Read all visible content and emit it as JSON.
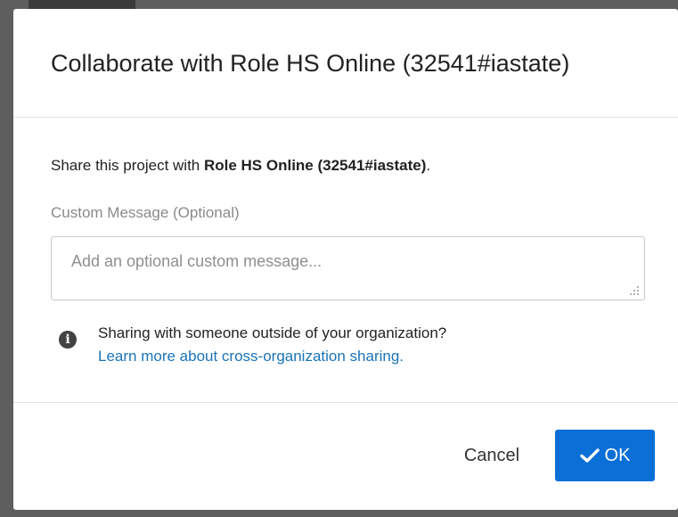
{
  "modal": {
    "title": "Collaborate with Role HS Online (32541#iastate)"
  },
  "share": {
    "prefix": "Share this project with ",
    "target": "Role HS Online (32541#iastate)",
    "suffix": "."
  },
  "custom_message": {
    "label": "Custom Message (Optional)",
    "placeholder": "Add an optional custom message...",
    "value": ""
  },
  "info": {
    "icon": "info-icon",
    "question": "Sharing with someone outside of your organization?",
    "link_text": "Learn more about cross-organization sharing."
  },
  "footer": {
    "cancel_label": "Cancel",
    "ok_label": "OK",
    "ok_icon": "checkmark-icon"
  },
  "colors": {
    "primary": "#0a6fd6",
    "link": "#1a73b8",
    "backdrop": "#5e5e5e"
  }
}
